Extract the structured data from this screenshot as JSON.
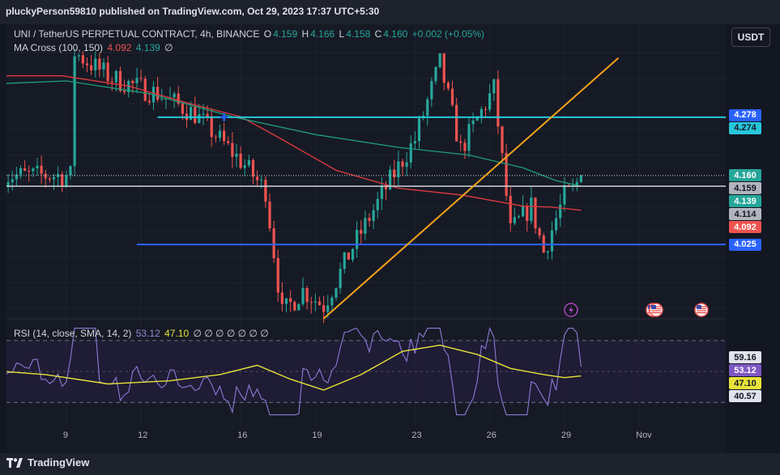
{
  "header": {
    "publisher": "pluckyPerson59810 published on TradingView.com, Oct 29, 2023 17:37 UTC+5:30"
  },
  "legend": {
    "symbol": "UNI / TetherUS PERPETUAL CONTRACT, 4h, BINANCE",
    "o_label": "O",
    "o": "4.159",
    "h_label": "H",
    "h": "4.166",
    "l_label": "L",
    "l": "4.158",
    "c_label": "C",
    "c": "4.160",
    "change": "+0.002 (+0.05%)",
    "ma_label": "MA Cross (100, 150)",
    "ma1": "4.092",
    "ma2": "4.139",
    "ma_extra": "∅"
  },
  "rsi_legend": {
    "label": "RSI (14, close, SMA, 14, 2)",
    "v1": "53.12",
    "v2": "47.10",
    "extras": "∅ ∅ ∅ ∅ ∅ ∅ ∅"
  },
  "currency_button": "USDT",
  "footer": {
    "brand": "TradingView"
  },
  "colors": {
    "up": "#26a69a",
    "down": "#ef5350",
    "bg": "#131722",
    "ma_fast": "#e03a3e",
    "ma_slow": "#1f9e7a",
    "cyan_line": "#26c6da",
    "blue_line": "#2962ff",
    "trend_line": "#f7a21b",
    "rsi": "#8d79d6",
    "rsi_ma": "#e8e33a"
  },
  "price_badges": [
    {
      "label": "4.278",
      "value": 4.278,
      "bg": "#2962ff",
      "fg": "#ffffff"
    },
    {
      "label": "4.274",
      "value": 4.274,
      "bg": "#26c6da",
      "fg": "#131722"
    },
    {
      "label": "4.160",
      "value": 4.16,
      "bg": "#26a69a",
      "fg": "#ffffff"
    },
    {
      "label": "4.159",
      "value": 4.159,
      "bg": "#b2b5be",
      "fg": "#131722"
    },
    {
      "label": "4.139",
      "value": 4.139,
      "bg": "#26a69a",
      "fg": "#ffffff"
    },
    {
      "label": "4.114",
      "value": 4.114,
      "bg": "#b2b5be",
      "fg": "#131722"
    },
    {
      "label": "4.092",
      "value": 4.092,
      "bg": "#ef5350",
      "fg": "#ffffff"
    },
    {
      "label": "4.025",
      "value": 4.025,
      "bg": "#2962ff",
      "fg": "#ffffff"
    }
  ],
  "rsi_badges": [
    {
      "label": "59.16",
      "value": 59.16,
      "bg": "#e0e3eb",
      "fg": "#131722"
    },
    {
      "label": "53.12",
      "value": 53.12,
      "bg": "#7e57c2",
      "fg": "#ffffff"
    },
    {
      "label": "47.10",
      "value": 47.1,
      "bg": "#e8e33a",
      "fg": "#131722"
    },
    {
      "label": "40.57",
      "value": 40.57,
      "bg": "#e0e3eb",
      "fg": "#131722"
    }
  ],
  "chart_data": {
    "type": "candlestick",
    "price_axis": {
      "ticks": [
        "4.400",
        "4.350",
        "4.300",
        "4.250",
        "4.200",
        "4.150",
        "4.100",
        "4.050",
        "4.000",
        "3.950",
        "3.900"
      ],
      "range": [
        3.87,
        4.44
      ]
    },
    "time_axis": {
      "ticks": [
        {
          "label": "9",
          "bar": 15
        },
        {
          "label": "12",
          "bar": 33
        },
        {
          "label": "16",
          "bar": 57
        },
        {
          "label": "19",
          "bar": 75
        },
        {
          "label": "23",
          "bar": 99
        },
        {
          "label": "26",
          "bar": 117
        },
        {
          "label": "29",
          "bar": 135
        },
        {
          "label": "Nov",
          "bar": 153
        }
      ]
    },
    "lines": {
      "cyan_horizontal": {
        "value": 4.274,
        "from_bar": 37
      },
      "blue_horizontal": {
        "value": 4.025,
        "from_bar": 32
      },
      "white_horizontal": {
        "value": 4.139
      },
      "dotted_last_price": {
        "value": 4.16
      },
      "trend_line": {
        "from_bar": 77,
        "from_value": 3.88,
        "to_bar": 148,
        "to_value": 4.39
      }
    },
    "anchor_points": [
      {
        "bar": 17,
        "value": 4.4
      },
      {
        "bar": 26,
        "value": 4.35
      },
      {
        "bar": 37,
        "value": 4.32
      },
      {
        "bar": 46,
        "value": 4.28
      },
      {
        "bar": 58,
        "value": 4.18
      },
      {
        "bar": 63,
        "value": 4.13
      },
      {
        "bar": 67,
        "value": 3.89
      },
      {
        "bar": 72,
        "value": 3.935
      },
      {
        "bar": 77,
        "value": 3.905
      },
      {
        "bar": 84,
        "value": 4.02
      },
      {
        "bar": 93,
        "value": 4.15
      },
      {
        "bar": 99,
        "value": 4.23
      },
      {
        "bar": 105,
        "value": 4.38
      },
      {
        "bar": 110,
        "value": 4.21
      },
      {
        "bar": 118,
        "value": 4.33
      },
      {
        "bar": 122,
        "value": 4.05
      },
      {
        "bar": 127,
        "value": 4.1
      },
      {
        "bar": 130,
        "value": 4.01
      },
      {
        "bar": 135,
        "value": 4.12
      },
      {
        "bar": 137,
        "value": 4.13
      },
      {
        "bar": 139,
        "value": 4.16
      }
    ],
    "ma_fast_points": [
      {
        "bar": 0,
        "value": 4.355
      },
      {
        "bar": 14,
        "value": 4.355
      },
      {
        "bar": 30,
        "value": 4.335
      },
      {
        "bar": 45,
        "value": 4.3
      },
      {
        "bar": 57,
        "value": 4.275
      },
      {
        "bar": 66,
        "value": 4.235
      },
      {
        "bar": 80,
        "value": 4.17
      },
      {
        "bar": 95,
        "value": 4.135
      },
      {
        "bar": 110,
        "value": 4.122
      },
      {
        "bar": 125,
        "value": 4.1
      },
      {
        "bar": 132,
        "value": 4.098
      },
      {
        "bar": 139,
        "value": 4.092
      }
    ],
    "ma_slow_points": [
      {
        "bar": 0,
        "value": 4.34
      },
      {
        "bar": 15,
        "value": 4.345
      },
      {
        "bar": 35,
        "value": 4.32
      },
      {
        "bar": 55,
        "value": 4.275
      },
      {
        "bar": 75,
        "value": 4.24
      },
      {
        "bar": 95,
        "value": 4.215
      },
      {
        "bar": 112,
        "value": 4.2
      },
      {
        "bar": 125,
        "value": 4.175
      },
      {
        "bar": 133,
        "value": 4.15
      },
      {
        "bar": 139,
        "value": 4.139
      }
    ],
    "rsi": {
      "axis_ticks": [
        "80.00",
        "20.00"
      ],
      "range": [
        15,
        83
      ],
      "band": [
        70,
        30
      ],
      "mid": 50,
      "rsi_ma_points": [
        {
          "bar": 0,
          "value": 50
        },
        {
          "bar": 10,
          "value": 48
        },
        {
          "bar": 25,
          "value": 42
        },
        {
          "bar": 40,
          "value": 44
        },
        {
          "bar": 52,
          "value": 48
        },
        {
          "bar": 61,
          "value": 54
        },
        {
          "bar": 69,
          "value": 45
        },
        {
          "bar": 77,
          "value": 38
        },
        {
          "bar": 86,
          "value": 48
        },
        {
          "bar": 96,
          "value": 63
        },
        {
          "bar": 105,
          "value": 67
        },
        {
          "bar": 114,
          "value": 61
        },
        {
          "bar": 122,
          "value": 52
        },
        {
          "bar": 130,
          "value": 48
        },
        {
          "bar": 135,
          "value": 46
        },
        {
          "bar": 139,
          "value": 47.1
        }
      ]
    },
    "event_icons": [
      "lightning-icon",
      "us-flag-icon",
      "us-flag-icon",
      "us-flag-icon"
    ]
  }
}
